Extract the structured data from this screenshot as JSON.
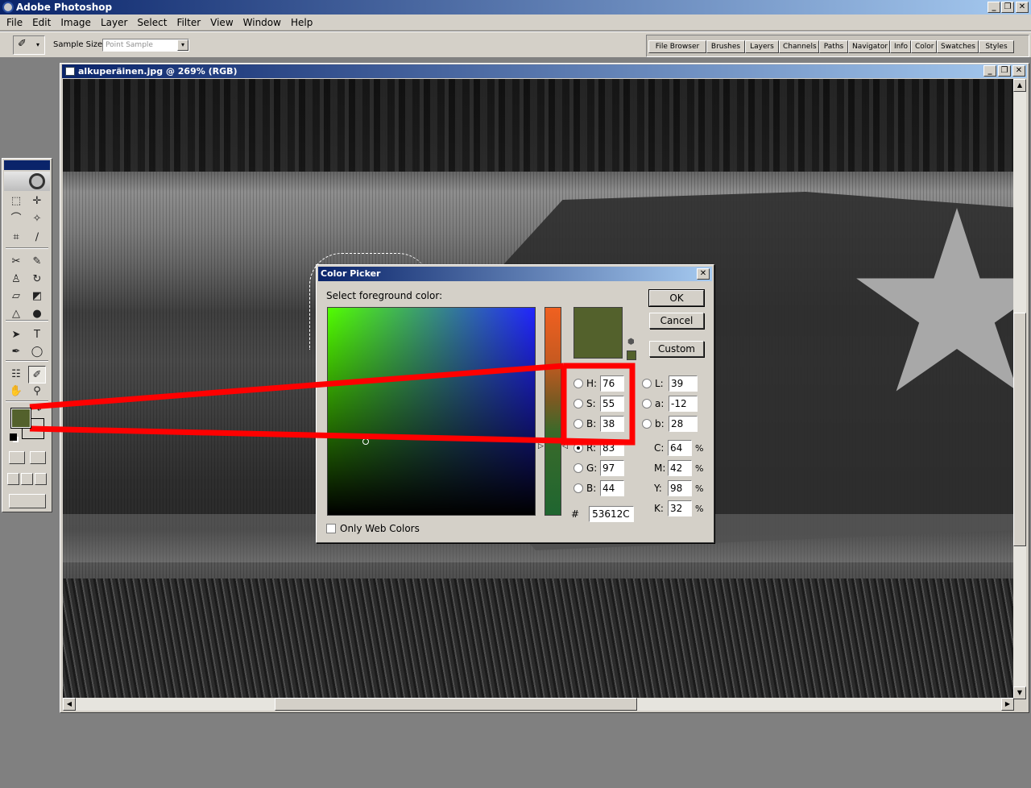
{
  "app": {
    "title": "Adobe Photoshop",
    "window_controls": {
      "minimize": "_",
      "maximize": "❐",
      "close": "✕"
    }
  },
  "menu": [
    "File",
    "Edit",
    "Image",
    "Layer",
    "Select",
    "Filter",
    "View",
    "Window",
    "Help"
  ],
  "options_bar": {
    "sample_size_label": "Sample Size:",
    "sample_size_value": "Point Sample",
    "palette_tabs": [
      "File Browser",
      "Brushes",
      "Layers",
      "Channels",
      "Paths",
      "Navigator",
      "Info",
      "Color",
      "Swatches",
      "Styles"
    ]
  },
  "toolbox": {
    "foreground_color": "#53612c",
    "background_color": "#d4d0c8",
    "tools": [
      {
        "name": "marquee-tool-icon",
        "glyph": "⬚"
      },
      {
        "name": "move-tool-icon",
        "glyph": "✛"
      },
      {
        "name": "lasso-tool-icon",
        "glyph": "⌒"
      },
      {
        "name": "magic-wand-tool-icon",
        "glyph": "✧"
      },
      {
        "name": "crop-tool-icon",
        "glyph": "⌗"
      },
      {
        "name": "slice-tool-icon",
        "glyph": "∕"
      },
      {
        "name": "healing-brush-tool-icon",
        "glyph": "✂"
      },
      {
        "name": "brush-tool-icon",
        "glyph": "✎"
      },
      {
        "name": "clone-stamp-tool-icon",
        "glyph": "♙"
      },
      {
        "name": "history-brush-tool-icon",
        "glyph": "↻"
      },
      {
        "name": "eraser-tool-icon",
        "glyph": "▱"
      },
      {
        "name": "paint-bucket-tool-icon",
        "glyph": "◩"
      },
      {
        "name": "blur-tool-icon",
        "glyph": "△"
      },
      {
        "name": "dodge-tool-icon",
        "glyph": "●"
      },
      {
        "name": "path-selection-tool-icon",
        "glyph": "➤"
      },
      {
        "name": "type-tool-icon",
        "glyph": "T"
      },
      {
        "name": "pen-tool-icon",
        "glyph": "✒"
      },
      {
        "name": "ellipse-tool-icon",
        "glyph": "◯"
      },
      {
        "name": "notes-tool-icon",
        "glyph": "☷"
      },
      {
        "name": "eyedropper-tool-icon",
        "glyph": "✐"
      },
      {
        "name": "hand-tool-icon",
        "glyph": "✋"
      },
      {
        "name": "zoom-tool-icon",
        "glyph": "⚲"
      }
    ]
  },
  "document": {
    "title": "alkuperäinen.jpg @ 269% (RGB)"
  },
  "color_picker": {
    "title": "Color Picker",
    "close_label": "✕",
    "prompt": "Select foreground color:",
    "new_color": "#53612c",
    "buttons": {
      "ok": "OK",
      "cancel": "Cancel",
      "custom": "Custom"
    },
    "hsb": [
      {
        "label": "H:",
        "value": "76",
        "unit": "°",
        "checked": false
      },
      {
        "label": "S:",
        "value": "55",
        "unit": "%",
        "checked": false
      },
      {
        "label": "B:",
        "value": "38",
        "unit": "%",
        "checked": false
      }
    ],
    "rgb": [
      {
        "label": "R:",
        "value": "83",
        "checked": true
      },
      {
        "label": "G:",
        "value": "97",
        "checked": false
      },
      {
        "label": "B:",
        "value": "44",
        "checked": false
      }
    ],
    "lab": [
      {
        "label": "L:",
        "value": "39"
      },
      {
        "label": "a:",
        "value": "-12"
      },
      {
        "label": "b:",
        "value": "28"
      }
    ],
    "cmyk": [
      {
        "label": "C:",
        "value": "64",
        "unit": "%"
      },
      {
        "label": "M:",
        "value": "42",
        "unit": "%"
      },
      {
        "label": "Y:",
        "value": "98",
        "unit": "%"
      },
      {
        "label": "K:",
        "value": "32",
        "unit": "%"
      }
    ],
    "hex_label": "#",
    "hex_value": "53612C",
    "only_web_colors_label": "Only Web Colors"
  },
  "annotation_color": "#ff0000"
}
